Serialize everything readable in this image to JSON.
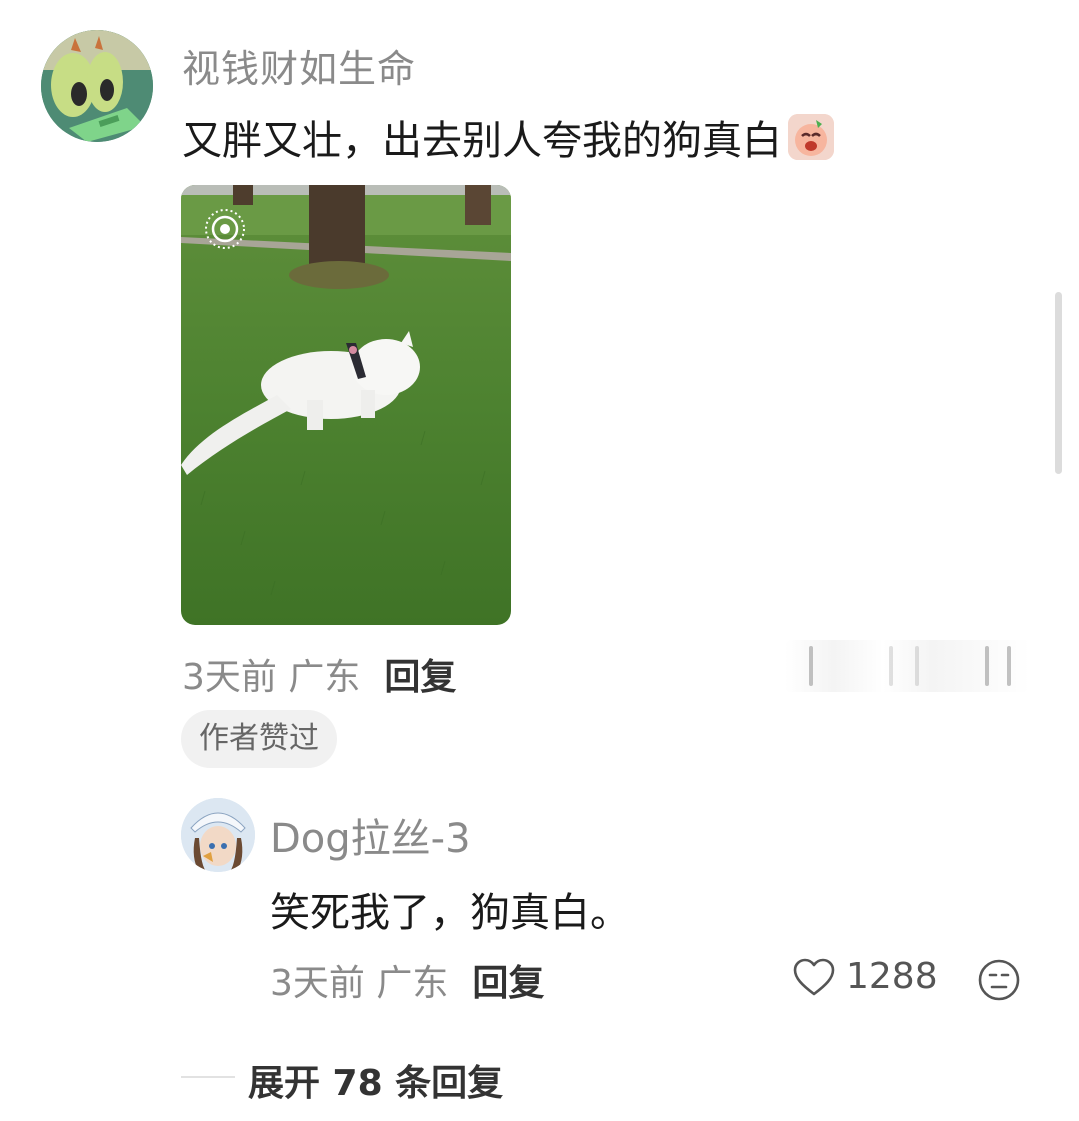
{
  "main_comment": {
    "username": "视钱财如生命",
    "text": "又胖又壮，出去别人夸我的狗真白",
    "meta_time": "3天前",
    "meta_location": "广东",
    "reply_label": "回复",
    "badge": "作者赞过"
  },
  "reply_comment": {
    "username": "Dog拉丝-3",
    "text": "笑死我了，狗真白。",
    "meta_time": "3天前",
    "meta_location": "广东",
    "reply_label": "回复",
    "like_count": "1288"
  },
  "expand": {
    "label": "展开 78 条回复"
  },
  "icons": {
    "live_photo": "live-photo-icon",
    "like": "heart-outline-icon",
    "dislike": "neutral-face-icon",
    "sticker": "crying-face-sticker-icon"
  },
  "colors": {
    "secondary_text": "#8a8a8a",
    "primary_text": "#1a1a1a",
    "badge_bg": "#f1f1f1"
  }
}
